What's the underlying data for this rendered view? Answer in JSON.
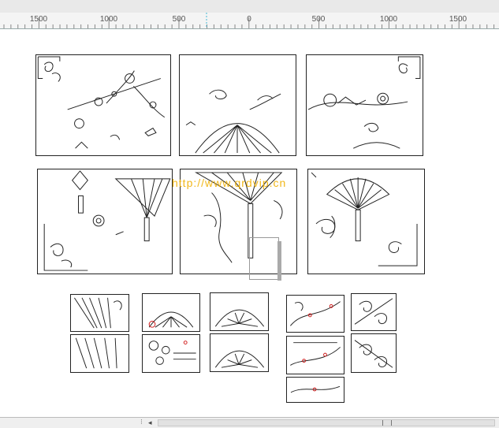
{
  "ruler": {
    "labels": [
      "1500",
      "1000",
      "500",
      "0",
      "500",
      "1000",
      "1500"
    ]
  },
  "watermark": {
    "text": "http://www.qrdvip.cn"
  },
  "colors": {
    "accent_ruler": "#42b8d6",
    "watermark": "#f0b000",
    "marks": "#d01818"
  }
}
